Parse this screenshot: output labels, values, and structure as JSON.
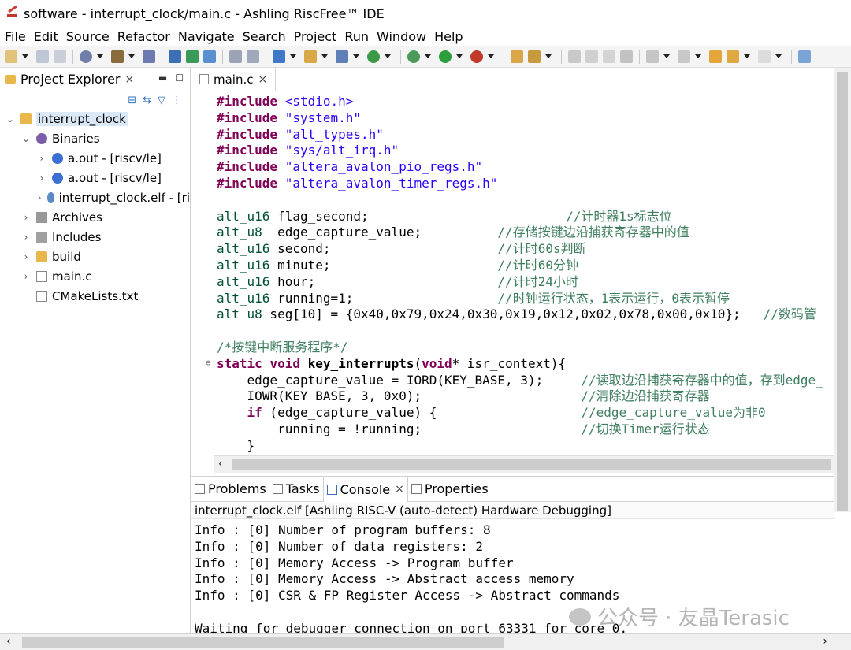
{
  "window": {
    "title": "software - interrupt_clock/main.c - Ashling RiscFree™ IDE"
  },
  "menu": [
    "File",
    "Edit",
    "Source",
    "Refactor",
    "Navigate",
    "Search",
    "Project",
    "Run",
    "Window",
    "Help"
  ],
  "project_explorer": {
    "tab_label": "Project Explorer",
    "tree": [
      {
        "label": "interrupt_clock",
        "icon": "project-folder-icon",
        "expanded": true
      },
      {
        "label": "Binaries",
        "icon": "binaries-icon",
        "expanded": true
      },
      {
        "label": "a.out - [riscv/le]",
        "icon": "binary-run-icon"
      },
      {
        "label": "a.out - [riscv/le]",
        "icon": "binary-run-icon"
      },
      {
        "label": "interrupt_clock.elf - [ri",
        "icon": "elf-gear-icon"
      },
      {
        "label": "Archives",
        "icon": "archives-icon"
      },
      {
        "label": "Includes",
        "icon": "includes-icon"
      },
      {
        "label": "build",
        "icon": "folder-icon"
      },
      {
        "label": "main.c",
        "icon": "c-file-icon"
      },
      {
        "label": "CMakeLists.txt",
        "icon": "text-file-icon"
      }
    ]
  },
  "editor": {
    "tab_label": "main.c",
    "lines": [
      "#include <stdio.h>",
      "#include \"system.h\"",
      "#include \"alt_types.h\"",
      "#include \"sys/alt_irq.h\"",
      "#include \"altera_avalon_pio_regs.h\"",
      "#include \"altera_avalon_timer_regs.h\"",
      "",
      "alt_u16 flag_second;                          //计时器1s标志位",
      "alt_u8  edge_capture_value;          //存储按键边沿捕获寄存器中的值",
      "alt_u16 second;                      //计时60s判断",
      "alt_u16 minute;                      //计时60分钟",
      "alt_u16 hour;                        //计时24小时",
      "alt_u16 running=1;                   //时钟运行状态，1表示运行，0表示暂停",
      "alt_u8 seg[10] = {0x40,0x79,0x24,0x30,0x19,0x12,0x02,0x78,0x00,0x10};   //数码管",
      "",
      "/*按键中断服务程序*/",
      "static void key_interrupts(void* isr_context){",
      "    edge_capture_value = IORD(KEY_BASE, 3);     //读取边沿捕获寄存器中的值，存到edge_",
      "    IOWR(KEY_BASE, 3, 0x0);                     //清除边沿捕获寄存器",
      "    if (edge_capture_value) {                   //edge_capture_value为非0",
      "        running = !running;                     //切换Timer运行状态",
      "    }",
      "}"
    ]
  },
  "bottom_panel": {
    "tabs": [
      "Problems",
      "Tasks",
      "Console",
      "Properties"
    ],
    "active_tab": "Console",
    "console_header": "interrupt_clock.elf [Ashling RISC-V (auto-detect) Hardware Debugging]",
    "console_lines": [
      "Info : [0] Number of program buffers: 8",
      "Info : [0] Number of data registers: 2",
      "Info : [0] Memory Access -> Program buffer",
      "Info : [0] Memory Access -> Abstract access memory",
      "Info : [0] CSR & FP Register Access -> Abstract commands",
      "",
      "Waiting for debugger connection on port 63331 for core 0."
    ]
  },
  "watermark": "公众号 · 友晶Terasic",
  "colors": {
    "keyword": "#7f0055",
    "string": "#2a00ff",
    "comment": "#3f7f5f",
    "selection": "#dbe9f7"
  }
}
